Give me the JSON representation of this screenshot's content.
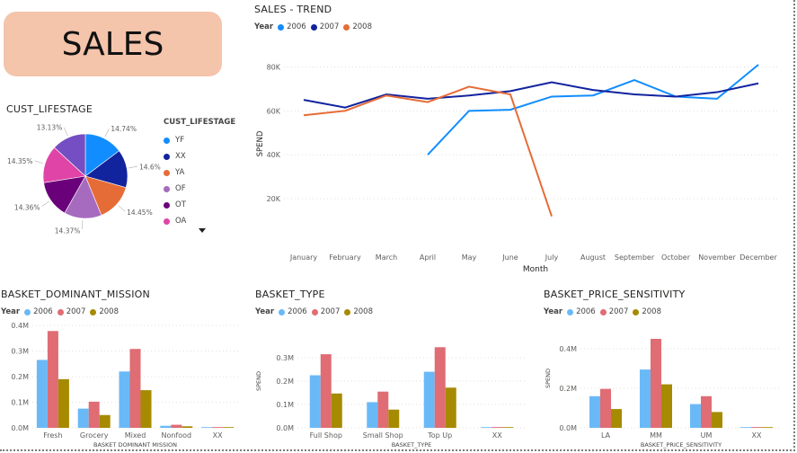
{
  "header": {
    "title": "SALES"
  },
  "colors": {
    "s2006": "#118dff",
    "s2007": "#12239e",
    "s2008": "#e66c37",
    "b2006": "#6ab9f7",
    "b2007": "#e06c74",
    "b2008": "#a68a00"
  },
  "pie": {
    "title": "CUST_LIFESTAGE",
    "legend_title": "CUST_LIFESTAGE",
    "chart_data": {
      "type": "pie",
      "slices": [
        {
          "label": "YF",
          "value": 14.74,
          "display": "14.74%",
          "color": "#118dff"
        },
        {
          "label": "XX",
          "value": 14.6,
          "display": "14.6%",
          "color": "#12239e"
        },
        {
          "label": "YA",
          "value": 14.45,
          "display": "14.45%",
          "color": "#e66c37"
        },
        {
          "label": "OF",
          "value": 14.37,
          "display": "14.37%",
          "color": "#a66bbe"
        },
        {
          "label": "OT",
          "value": 14.36,
          "display": "14.36%",
          "color": "#6b007b"
        },
        {
          "label": "OA",
          "value": 14.35,
          "display": "14.35%",
          "color": "#e044a7"
        },
        {
          "label": "",
          "value": 13.13,
          "display": "13.13%",
          "color": "#744ec2"
        }
      ]
    }
  },
  "trend": {
    "title": "SALES - TREND",
    "legend_title": "Year",
    "chart_data": {
      "type": "line",
      "categories": [
        "January",
        "February",
        "March",
        "April",
        "May",
        "June",
        "July",
        "August",
        "September",
        "October",
        "November",
        "December"
      ],
      "xlabel": "Month",
      "ylabel": "SPEND",
      "ylim": [
        0,
        90000
      ],
      "yticks": [
        20000,
        40000,
        60000,
        80000
      ],
      "ytick_labels": [
        "20K",
        "40K",
        "60K",
        "80K"
      ],
      "series": [
        {
          "name": "2006",
          "color": "#118dff",
          "values": [
            null,
            null,
            null,
            40000,
            60000,
            60500,
            66500,
            67000,
            74000,
            66500,
            65500,
            81000
          ]
        },
        {
          "name": "2007",
          "color": "#12239e",
          "values": [
            65000,
            61500,
            67500,
            65500,
            67000,
            69000,
            73000,
            69500,
            67500,
            66500,
            68500,
            72500
          ]
        },
        {
          "name": "2008",
          "color": "#e66c37",
          "values": [
            58000,
            60000,
            67000,
            64000,
            71000,
            67500,
            12000,
            null,
            null,
            null,
            null,
            null
          ]
        }
      ]
    }
  },
  "bar_charts": [
    {
      "title": "BASKET_DOMINANT_MISSION",
      "legend_title": "Year",
      "chart_data": {
        "type": "bar",
        "categories": [
          "Fresh",
          "Grocery",
          "Mixed",
          "Nonfood",
          "XX"
        ],
        "xlabel": "BASKET DOMINANT MISSION",
        "ylabel": "",
        "ylim": [
          0,
          400000
        ],
        "yticks": [
          0,
          100000,
          200000,
          300000,
          400000
        ],
        "ytick_labels": [
          "0.0M",
          "0.1M",
          "0.2M",
          "0.3M",
          "0.4M"
        ],
        "series": [
          {
            "name": "2006",
            "color": "#6ab9f7",
            "values": [
              265000,
              75000,
              220000,
              8000,
              2000
            ]
          },
          {
            "name": "2007",
            "color": "#e06c74",
            "values": [
              378000,
              102000,
              308000,
              12000,
              3000
            ]
          },
          {
            "name": "2008",
            "color": "#a68a00",
            "values": [
              190000,
              50000,
              147000,
              6000,
              1500
            ]
          }
        ]
      }
    },
    {
      "title": "BASKET_TYPE",
      "legend_title": "Year",
      "chart_data": {
        "type": "bar",
        "categories": [
          "Full Shop",
          "Small Shop",
          "Top Up",
          "XX"
        ],
        "xlabel": "BASKET_TYPE",
        "ylabel": "SPEND",
        "ylim": [
          0,
          400000
        ],
        "yticks": [
          0,
          100000,
          200000,
          300000
        ],
        "ytick_labels": [
          "0.0M",
          "0.1M",
          "0.2M",
          "0.3M"
        ],
        "series": [
          {
            "name": "2006",
            "color": "#6ab9f7",
            "values": [
              225000,
              110000,
              240000,
              3000
            ]
          },
          {
            "name": "2007",
            "color": "#e06c74",
            "values": [
              315000,
              155000,
              345000,
              3500
            ]
          },
          {
            "name": "2008",
            "color": "#a68a00",
            "values": [
              147000,
              78000,
              172000,
              2000
            ]
          }
        ]
      }
    },
    {
      "title": "BASKET_PRICE_SENSITIVITY",
      "legend_title": "Year",
      "chart_data": {
        "type": "bar",
        "categories": [
          "LA",
          "MM",
          "UM",
          "XX"
        ],
        "xlabel": "BASKET_PRICE_SENSITIVITY",
        "ylabel": "SPEND",
        "ylim": [
          0,
          500000
        ],
        "yticks": [
          0,
          200000,
          400000
        ],
        "ytick_labels": [
          "0.0M",
          "0.2M",
          "0.4M"
        ],
        "series": [
          {
            "name": "2006",
            "color": "#6ab9f7",
            "values": [
              160000,
              295000,
              120000,
              3000
            ]
          },
          {
            "name": "2007",
            "color": "#e06c74",
            "values": [
              197000,
              450000,
              160000,
              4000
            ]
          },
          {
            "name": "2008",
            "color": "#a68a00",
            "values": [
              95000,
              220000,
              80000,
              2000
            ]
          }
        ]
      }
    }
  ]
}
